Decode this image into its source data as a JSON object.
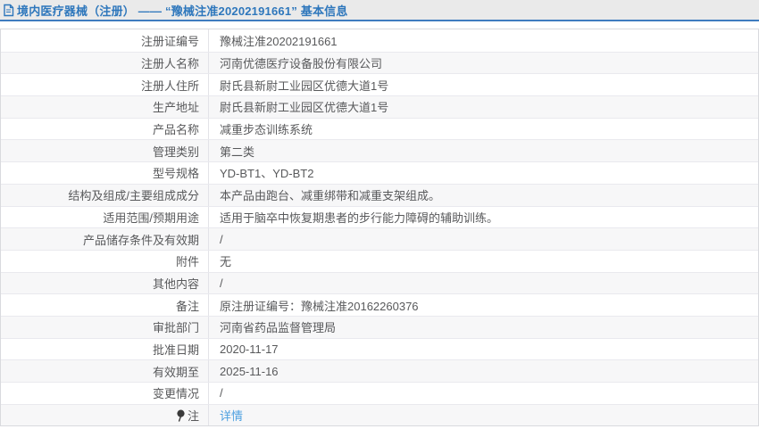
{
  "page": {
    "title": "境内医疗器械（注册） —— “豫械注准20202191661” 基本信息"
  },
  "colors": {
    "title_text": "#2e77bc",
    "title_bar_bg": "#eaeaea",
    "title_underline": "#3f7cbf",
    "row_alt_bg": "#f7f7f8",
    "table_border": "#d9dade",
    "cell_text": "#58595b",
    "link_blue": "#4da0e0"
  },
  "icons": {
    "title_icon": "document-icon",
    "note_icon": "pin-icon"
  },
  "table": {
    "rows": [
      {
        "label": "注册证编号",
        "value": "豫械注准20202191661"
      },
      {
        "label": "注册人名称",
        "value": "河南优德医疗设备股份有限公司"
      },
      {
        "label": "注册人住所",
        "value": "尉氏县新尉工业园区优德大道1号"
      },
      {
        "label": "生产地址",
        "value": "尉氏县新尉工业园区优德大道1号"
      },
      {
        "label": "产品名称",
        "value": "减重步态训练系统"
      },
      {
        "label": "管理类别",
        "value": "第二类"
      },
      {
        "label": "型号规格",
        "value": "YD-BT1、YD-BT2"
      },
      {
        "label": "结构及组成/主要组成成分",
        "value": "本产品由跑台、减重绑带和减重支架组成。"
      },
      {
        "label": "适用范围/预期用途",
        "value": "适用于脑卒中恢复期患者的步行能力障碍的辅助训练。"
      },
      {
        "label": "产品储存条件及有效期",
        "value": "/"
      },
      {
        "label": "附件",
        "value": "无"
      },
      {
        "label": "其他内容",
        "value": "/"
      },
      {
        "label": "备注",
        "value": "原注册证编号：豫械注准20162260376"
      },
      {
        "label": "审批部门",
        "value": "河南省药品监督管理局"
      },
      {
        "label": "批准日期",
        "value": "2020-11-17"
      },
      {
        "label": "有效期至",
        "value": "2025-11-16"
      },
      {
        "label": "变更情况",
        "value": "/"
      },
      {
        "label": "注",
        "value": "详情",
        "value_is_link": true,
        "label_icon": "pin-icon"
      }
    ]
  }
}
